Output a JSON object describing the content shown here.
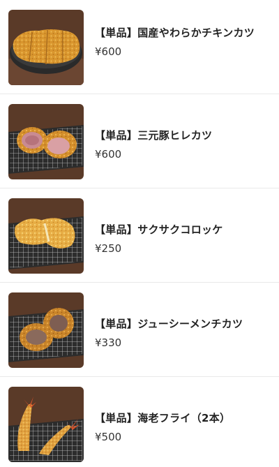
{
  "menu": {
    "items": [
      {
        "name": "【単品】国産やわらかチキンカツ",
        "price": "¥600",
        "image": "chicken-katsu-icon"
      },
      {
        "name": "【単品】三元豚ヒレカツ",
        "price": "¥600",
        "image": "hire-katsu-icon"
      },
      {
        "name": "【単品】サクサクコロッケ",
        "price": "¥250",
        "image": "croquette-icon"
      },
      {
        "name": "【単品】ジューシーメンチカツ",
        "price": "¥330",
        "image": "menchi-katsu-icon"
      },
      {
        "name": "【単品】海老フライ（2本）",
        "price": "¥500",
        "image": "ebi-fry-icon"
      }
    ]
  },
  "colors": {
    "background": "#ffffff",
    "divider": "#e9e9e9",
    "text": "#222222",
    "table_wood": "#5a3a28",
    "fried_crust": "#d9962e"
  }
}
